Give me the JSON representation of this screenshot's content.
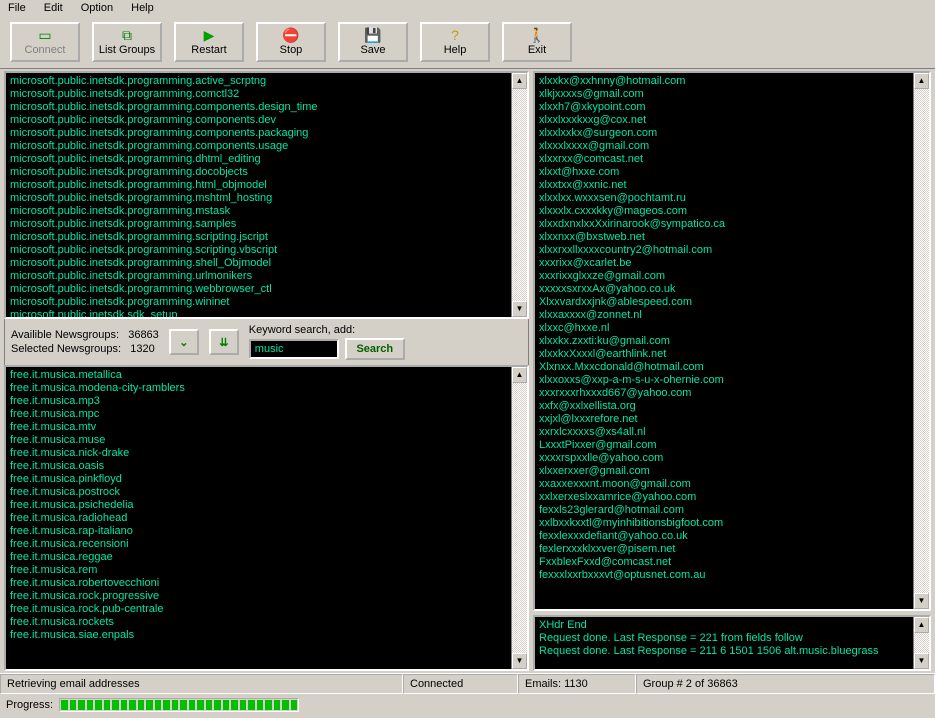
{
  "menu": {
    "file": "File",
    "edit": "Edit",
    "option": "Option",
    "help": "Help"
  },
  "toolbar": {
    "connect": "Connect",
    "listgroups": "List Groups",
    "restart": "Restart",
    "stop": "Stop",
    "save": "Save",
    "help": "Help",
    "exit": "Exit"
  },
  "top_groups": [
    "microsoft.public.inetsdk.programming.active_scrptng",
    "microsoft.public.inetsdk.programming.comctl32",
    "microsoft.public.inetsdk.programming.components.design_time",
    "microsoft.public.inetsdk.programming.components.dev",
    "microsoft.public.inetsdk.programming.components.packaging",
    "microsoft.public.inetsdk.programming.components.usage",
    "microsoft.public.inetsdk.programming.dhtml_editing",
    "microsoft.public.inetsdk.programming.docobjects",
    "microsoft.public.inetsdk.programming.html_objmodel",
    "microsoft.public.inetsdk.programming.mshtml_hosting",
    "microsoft.public.inetsdk.programming.mstask",
    "microsoft.public.inetsdk.programming.samples",
    "microsoft.public.inetsdk.programming.scripting.jscript",
    "microsoft.public.inetsdk.programming.scripting.vbscript",
    "microsoft.public.inetsdk.programming.shell_Objmodel",
    "microsoft.public.inetsdk.programming.urlmonikers",
    "microsoft.public.inetsdk.programming.webbrowser_ctl",
    "microsoft.public.inetsdk.programming.wininet",
    "microsoft.public.inetsdk.sdk_setup"
  ],
  "counts": {
    "available_label": "Availible Newsgroups:",
    "available_value": "36863",
    "selected_label": "Selected Newsgroups:",
    "selected_value": "1320"
  },
  "search": {
    "label": "Keyword search, add:",
    "value": "music",
    "button": "Search"
  },
  "bottom_groups": [
    "free.it.musica.metallica",
    "free.it.musica.modena-city-ramblers",
    "free.it.musica.mp3",
    "free.it.musica.mpc",
    "free.it.musica.mtv",
    "free.it.musica.muse",
    "free.it.musica.nick-drake",
    "free.it.musica.oasis",
    "free.it.musica.pinkfloyd",
    "free.it.musica.postrock",
    "free.it.musica.psichedelia",
    "free.it.musica.radiohead",
    "free.it.musica.rap-italiano",
    "free.it.musica.recensioni",
    "free.it.musica.reggae",
    "free.it.musica.rem",
    "free.it.musica.robertovecchioni",
    "free.it.musica.rock.progressive",
    "free.it.musica.rock.pub-centrale",
    "free.it.musica.rockets",
    "free.it.musica.siae.enpals"
  ],
  "emails": [
    "xlxxkx@xxhnny@hotmail.com",
    "xlkjxxxxs@gmail.com",
    "xlxxh7@xkypoint.com",
    "xlxxlxxxkxxg@cox.net",
    "xlxxlxxkx@surgeon.com",
    "xlxxxlxxxx@gmail.com",
    "xlxxrxx@comcast.net",
    "xlxxt@hxxe.com",
    "xlxxtxx@xxnic.net",
    "xlxxlxx.wxxxsen@pochtamt.ru",
    "xlxxxlx.cxxxkky@mageos.com",
    "xlxxdxnxlxxXxirinarook@sympatico.ca",
    "xlxxnxx@bxstweb.net",
    "xlxxrxxllxxxxcountry2@hotmail.com",
    "xxxrixx@xcarlet.be",
    "xxxrixxglxxze@gmail.com",
    "xxxxxsxrxxAx@yahoo.co.uk",
    "Xlxxvardxxjnk@ablespeed.com",
    "xlxxaxxxx@zonnet.nl",
    "xlxxc@hxxe.nl",
    "xlxxkx.zxxti:ku@gmail.com",
    "xlxxkxXxxxl@earthlink.net",
    "Xlxnxx.Mxxcdonald@hotmail.com",
    "xlxxoxxs@xxp-a-m-s-u-x-ohernie.com",
    "xxxrxxxrhxxxd667@yahoo.com",
    "xxfx@xxlxellista.org",
    "xxjxl@lxxxrefore.net",
    "xxrxlcxxxxs@xs4all.nl",
    "LxxxtPixxer@gmail.com",
    "xxxxrspxxlle@yahoo.com",
    "xlxxerxxer@gmail.com",
    "xxaxxexxxnt.moon@gmail.com",
    "xxlxerxeslxxamrice@yahoo.com",
    "fexxls23glerard@hotmail.com",
    "xxlbxxkxxtl@myinhibitionsbigfoot.com",
    "fexxlexxxdefiant@yahoo.co.uk",
    "fexlerxxxklxxver@pisem.net",
    "FxxblexFxxd@comcast.net",
    "fexxxlxxrbxxxvt@optusnet.com.au"
  ],
  "log": [
    "XHdr End",
    "Request done. Last Response = 221 from fields follow",
    "Request done. Last Response = 211 6 1501 1506 alt.music.bluegrass"
  ],
  "status": {
    "task": "Retrieving email addresses",
    "conn": "Connected",
    "emails": "Emails: 1130",
    "group": "Group # 2 of 36863"
  },
  "progress": {
    "label": "Progress:"
  }
}
